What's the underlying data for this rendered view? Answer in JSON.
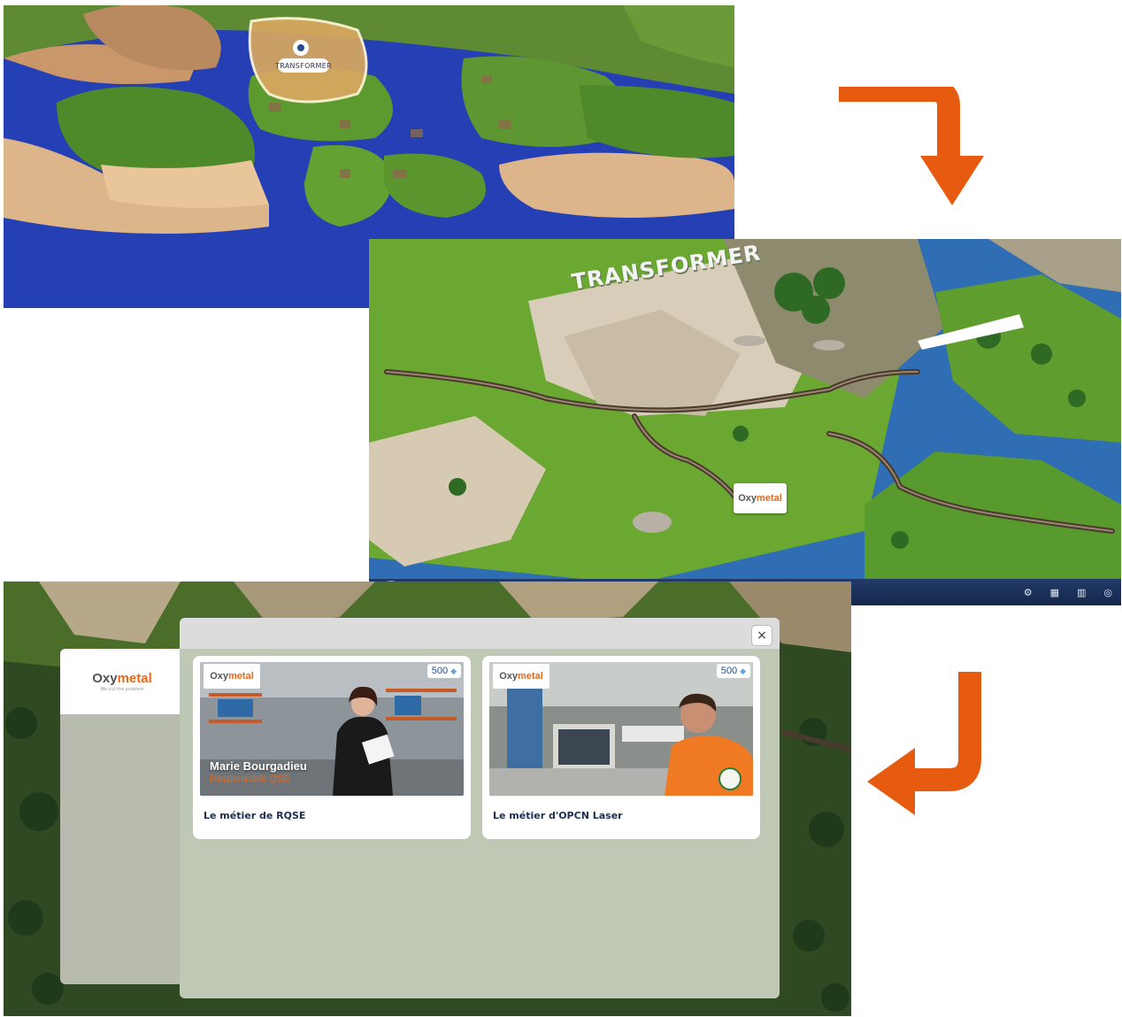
{
  "overview": {
    "zone_tag": "TRANSFORMER"
  },
  "zone_view": {
    "title": "TRANSFORMER",
    "sign_logo": {
      "word_a": "Oxy",
      "word_b": "metal"
    },
    "hud": {
      "left_labels": [
        "",
        ""
      ],
      "buttons": [
        {
          "icon": "gear-icon",
          "label": ""
        },
        {
          "icon": "grid-icon",
          "label": ""
        },
        {
          "icon": "chart-icon",
          "label": ""
        },
        {
          "icon": "target-icon",
          "label": ""
        }
      ]
    }
  },
  "modal_view": {
    "side_logo": {
      "word_a": "Oxy",
      "word_b": "metal",
      "tagline": "We cut the problem"
    },
    "close_label": "×",
    "cards": [
      {
        "logo_a": "Oxy",
        "logo_b": "metal",
        "points": "500",
        "person_name": "Marie Bourgadieu",
        "person_role": "Responsable QSE",
        "title": "Le métier de RQSE"
      },
      {
        "logo_a": "Oxy",
        "logo_b": "metal",
        "points": "500",
        "title": "Le métier d'OPCN Laser"
      }
    ]
  },
  "colors": {
    "arrow": "#e65b10",
    "brand_orange": "#e8681c",
    "card_title": "#1d2e52",
    "modal_bg": "#bfc8b4"
  }
}
